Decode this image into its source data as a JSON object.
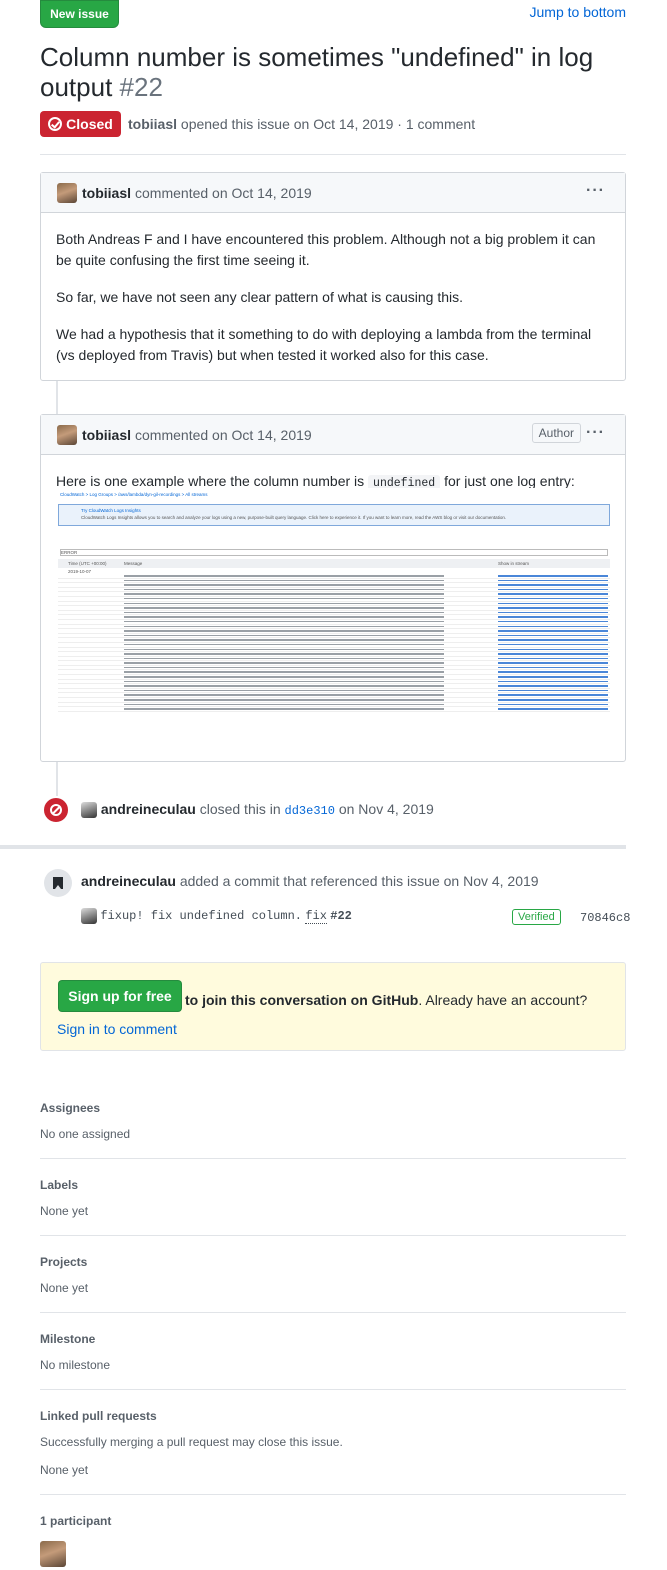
{
  "header": {
    "new_issue": "New issue",
    "jump_to_bottom": "Jump to bottom",
    "title": "Column number is sometimes \"undefined\" in log output",
    "number": "#22",
    "state": "Closed",
    "author": "tobiiasl",
    "opened_text": "opened this issue on Oct 14, 2019 · 1 comment"
  },
  "comments": [
    {
      "author": "tobiiasl",
      "meta": "commented on Oct 14, 2019",
      "paragraphs": [
        "Both Andreas F and I have encountered this problem. Although not a big problem it can be quite confusing the first time seeing it.",
        "So far, we have not seen any clear pattern of what is causing this.",
        "We had a hypothesis that it something to do with deploying a lambda from the terminal (vs deployed from Travis) but when tested it worked also for this case."
      ]
    },
    {
      "author": "tobiiasl",
      "meta": "commented on Oct 14, 2019",
      "badge": "Author",
      "text_before": "Here is one example where the column number is",
      "code": "undefined",
      "text_after": "for just one log entry:",
      "screenshot": {
        "breadcrumb": "CloudWatch  >  Log Groups  >  /aws/lambda/dyn-gil-recordings  >  All streams",
        "banner_title": "Try CloudWatch Logs Insights",
        "banner_body": "CloudWatch Logs Insights allows you to search and analyze your logs using a new, purpose-built query language. Click here to experience it. If you want to learn more, read the AWS blog or visit our documentation.",
        "filter": "ERROR",
        "col_time": "Time (UTC +00:00)",
        "col_message": "Message",
        "col_stream": "Show in stream",
        "date": "2019-10-07",
        "row_count": 30
      }
    }
  ],
  "events": {
    "closed_by": "andreineculau",
    "closed_text": "closed this in",
    "closed_commit": "dd3e310",
    "closed_date": "on Nov 4, 2019",
    "commit_author": "andreineculau",
    "commit_text": "added a commit that referenced this issue on Nov 4, 2019",
    "commit_message": "fixup! fix undefined column.",
    "commit_fix": "fix",
    "commit_ref": "#22",
    "verified": "Verified",
    "sha": "70846c8"
  },
  "signup": {
    "button": "Sign up for free",
    "bold_text": "to join this conversation on GitHub",
    "text": ". Already have an account?",
    "link": "Sign in to comment"
  },
  "sidebar": {
    "assignees_h": "Assignees",
    "assignees_v": "No one assigned",
    "labels_h": "Labels",
    "labels_v": "None yet",
    "projects_h": "Projects",
    "projects_v": "None yet",
    "milestone_h": "Milestone",
    "milestone_v": "No milestone",
    "linked_h": "Linked pull requests",
    "linked_desc": "Successfully merging a pull request may close this issue.",
    "linked_v": "None yet",
    "participants_h": "1 participant"
  }
}
